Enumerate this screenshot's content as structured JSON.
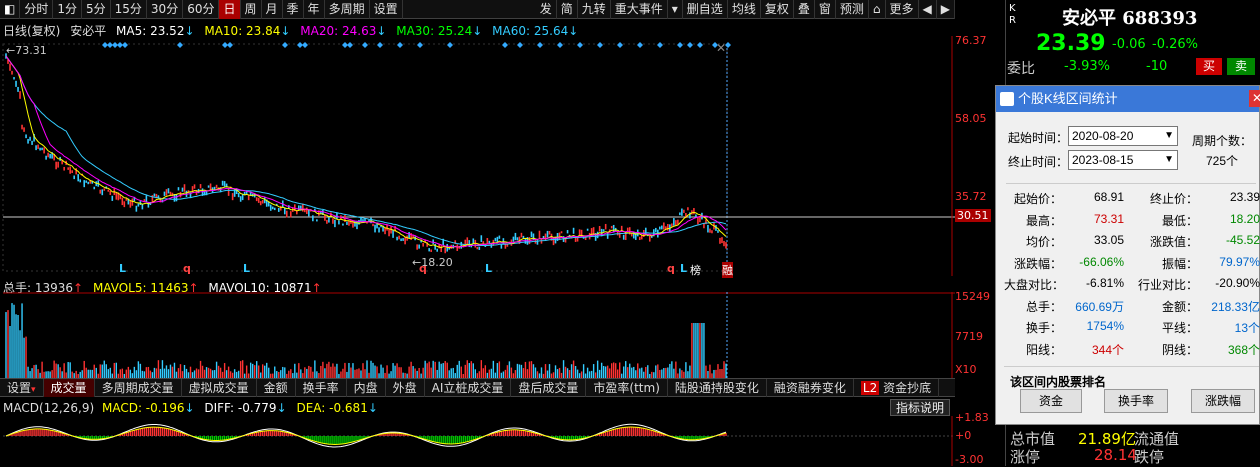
{
  "toolbar": {
    "periods": [
      "分时",
      "1分",
      "5分",
      "15分",
      "30分",
      "60分",
      "日",
      "周",
      "月",
      "季",
      "年",
      "多周期",
      "设置"
    ],
    "right_items": [
      "发",
      "简",
      "九转",
      "重大事件",
      "▾",
      "删自选",
      "均线",
      "复权",
      "叠",
      "窗",
      "预测",
      "⌂",
      "更多",
      "◀",
      "▶"
    ]
  },
  "ma_legend": {
    "title": "日线(复权)",
    "name": "安必平",
    "ma5": "MA5: 23.52",
    "ma10": "MA10: 23.84",
    "ma20": "MA20: 24.63",
    "ma30": "MA30: 25.24",
    "ma60": "MA60: 25.64"
  },
  "price_axis": [
    "76.37",
    "58.05",
    "35.72",
    "30.51",
    "18.20"
  ],
  "chart_marks": {
    "high": "73.31",
    "low": "18.20",
    "signals": [
      "L",
      "q",
      "L",
      "q",
      "L",
      "q",
      "L",
      "榜",
      "融"
    ]
  },
  "volume": {
    "total": "总手: 13936",
    "mavol5": "MAVOL5: 11463",
    "mavol10": "MAVOL10: 10871",
    "axis": [
      "15249",
      "7719",
      "X10"
    ]
  },
  "tabs": [
    "设置",
    "成交量",
    "多周期成交量",
    "虚拟成交量",
    "金额",
    "换手率",
    "内盘",
    "外盘",
    "AI立桩成交量",
    "盘后成交量",
    "市盈率(ttm)",
    "陆股通持股变化",
    "融资融券变化",
    "资金抄底"
  ],
  "macd": {
    "title": "MACD(12,26,9)",
    "macd": "MACD: -0.196",
    "diff": "DIFF: -0.779",
    "dea": "DEA: -0.681",
    "btn": "指标说明",
    "axis": [
      "+1.83",
      "+0",
      "-3.00"
    ]
  },
  "quote": {
    "name": "安必平 688393",
    "price": "23.39",
    "change": "-0.06",
    "pct": "-0.26%",
    "weibi_label": "委比",
    "weibi": "-3.93%",
    "weicha": "-10",
    "buy": "买",
    "sell": "卖",
    "left_tag": "KR"
  },
  "dialog": {
    "title": "个股K线区间统计",
    "start_label": "起始时间：",
    "start": "2020-08-20",
    "end_label": "终止时间：",
    "end": "2023-08-15",
    "period_label": "周期个数：",
    "period": "725个",
    "rows": [
      {
        "l1": "起始价：",
        "v1": "68.91",
        "l2": "终止价：",
        "v2": "23.39"
      },
      {
        "l1": "最高：",
        "v1": "73.31",
        "l2": "最低：",
        "v2": "18.20"
      },
      {
        "l1": "均价：",
        "v1": "33.05",
        "l2": "涨跌值：",
        "v2": "-45.52"
      },
      {
        "l1": "涨跌幅：",
        "v1": "-66.06%",
        "l2": "振幅：",
        "v2": "79.97%"
      },
      {
        "l1": "大盘对比：",
        "v1": "-6.81%",
        "l2": "行业对比：",
        "v2": "-20.90%"
      },
      {
        "l1": "总手：",
        "v1": "660.69万",
        "l2": "金额：",
        "v2": "218.33亿"
      },
      {
        "l1": "换手：",
        "v1": "1754%",
        "l2": "平线：",
        "v2": "13个"
      },
      {
        "l1": "阳线：",
        "v1": "344个",
        "l2": "阴线：",
        "v2": "368个"
      }
    ],
    "rank_title": "该区间内股票排名",
    "buttons": [
      "资金",
      "换手率",
      "涨跌幅"
    ]
  },
  "bottom": {
    "zsz_label": "总市值",
    "zsz": "21.89亿",
    "ltz_label": "流通值",
    "zt_label": "涨停",
    "zt": "28.14",
    "dt_label": "跌停"
  }
}
